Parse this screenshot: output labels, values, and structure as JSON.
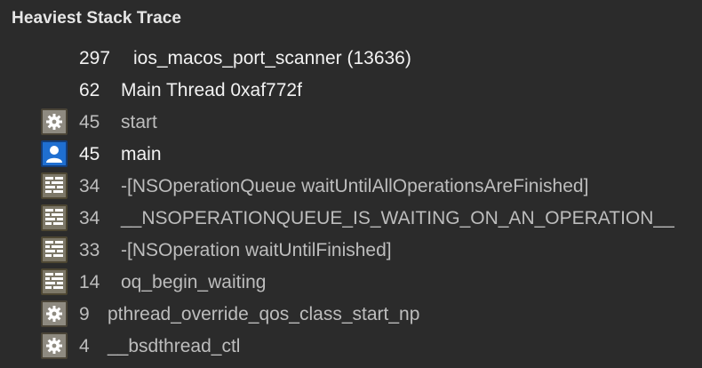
{
  "panel": {
    "title": "Heaviest Stack Trace"
  },
  "rows": [
    {
      "count": "297",
      "label": "ios_macos_port_scanner (13636)",
      "icon": ""
    },
    {
      "count": "62",
      "label": "Main Thread  0xaf772f",
      "icon": ""
    },
    {
      "count": "45",
      "label": "start",
      "icon": "gear-icon"
    },
    {
      "count": "45",
      "label": "main",
      "icon": "user-icon"
    },
    {
      "count": "34",
      "label": "-[NSOperationQueue waitUntilAllOperationsAreFinished]",
      "icon": "framework-icon"
    },
    {
      "count": "34",
      "label": "__NSOPERATIONQUEUE_IS_WAITING_ON_AN_OPERATION__",
      "icon": "framework-icon"
    },
    {
      "count": "33",
      "label": "-[NSOperation waitUntilFinished]",
      "icon": "framework-icon"
    },
    {
      "count": "14",
      "label": "oq_begin_waiting",
      "icon": "framework-icon"
    },
    {
      "count": "9",
      "label": "pthread_override_qos_class_start_np",
      "icon": "gear-icon"
    },
    {
      "count": "4",
      "label": "__bsdthread_ctl",
      "icon": "gear-icon"
    }
  ],
  "colors": {
    "background": "#2b2b2b",
    "text": "#e9e9e9",
    "dim_text": "#bdbdbd",
    "user_icon": "#1f6fd1",
    "system_icon": "#8e8a80",
    "framework_icon": "#7d7868"
  }
}
